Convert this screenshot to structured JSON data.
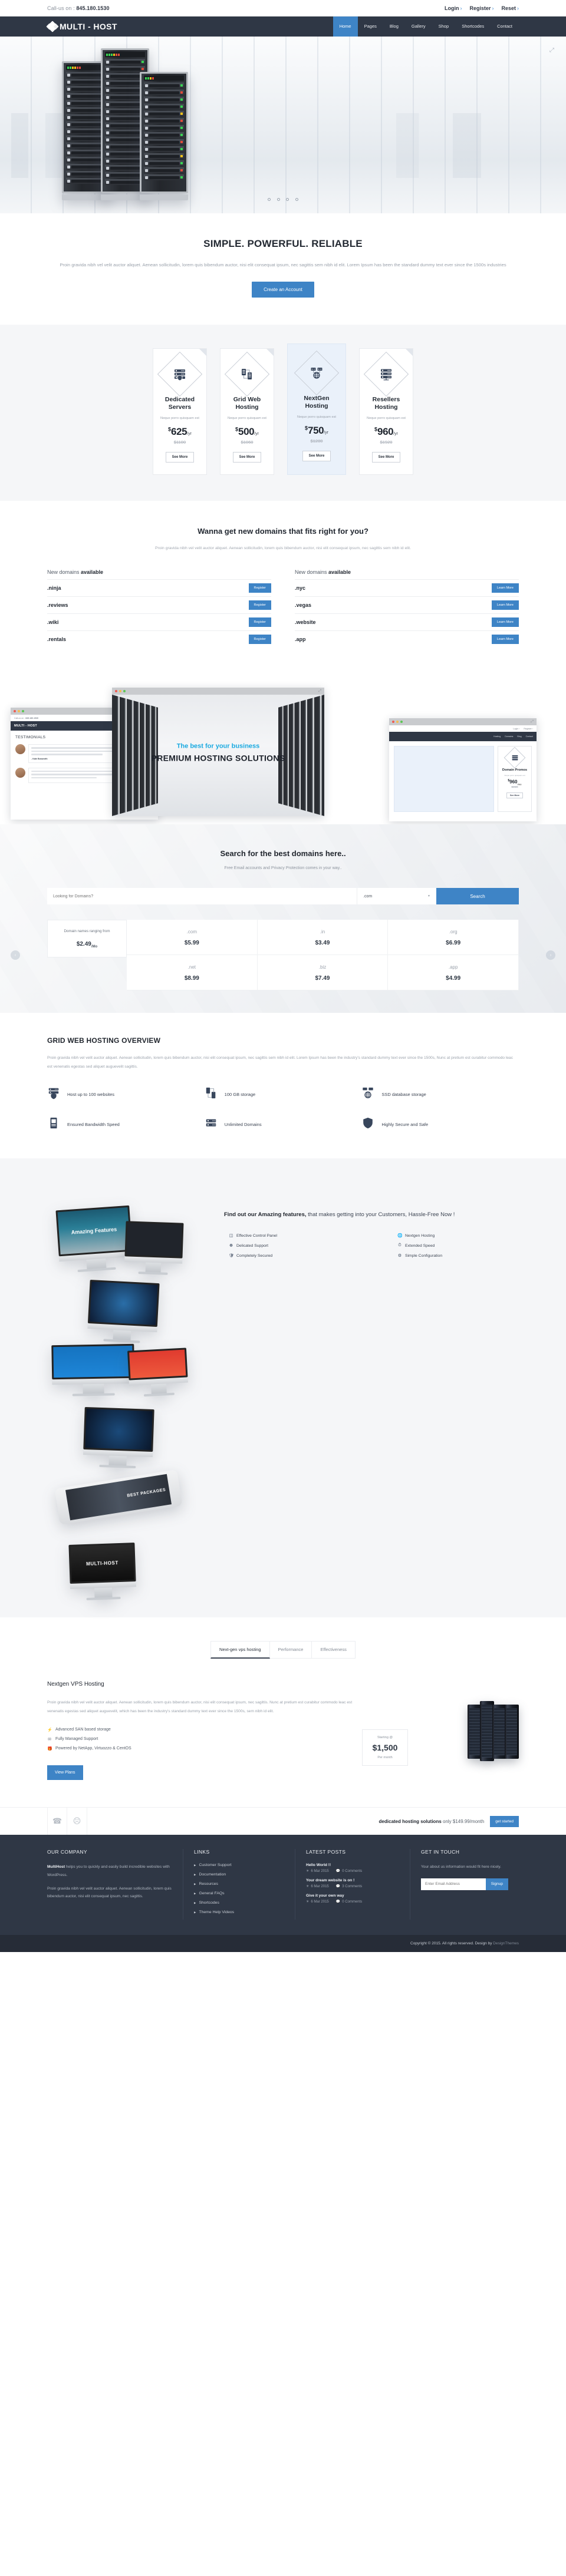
{
  "topbar": {
    "call_prefix": "Call-us on : ",
    "phone": "845.180.1530",
    "links": [
      {
        "label": "Login",
        "arrow": "›"
      },
      {
        "label": "Register",
        "arrow": "›"
      },
      {
        "label": "Reset",
        "arrow": "›"
      }
    ]
  },
  "header": {
    "brand": "MULTI - HOST",
    "nav": [
      {
        "label": "Home",
        "active": true
      },
      {
        "label": "Pages",
        "active": false
      },
      {
        "label": "Blog",
        "active": false
      },
      {
        "label": "Gallery",
        "active": false
      },
      {
        "label": "Shop",
        "active": false
      },
      {
        "label": "Shortcodes",
        "active": false
      },
      {
        "label": "Contact",
        "active": false
      }
    ]
  },
  "hero": {
    "slider_dots": 4,
    "expand_icon": "expand-icon"
  },
  "intro": {
    "title": "SIMPLE. POWERFUL. RELIABLE",
    "paragraph": "Proin gravida nibh vel velit auctor aliquet. Aenean sollicitudin, lorem quis bibendum auctor, nisi elit consequat ipsum, nec sagittis sem nibh id elit. Lorem Ipsum has been the  standard dummy text ever since the 1500s industries",
    "cta_label": "Create an Account"
  },
  "pricing": {
    "plans": [
      {
        "name": "Dedicated Servers",
        "sub": "Neque porro quisquam est",
        "cur": "$",
        "amount": "625",
        "per": "/yr",
        "old": "$1100",
        "button": "See More",
        "icon": "server-shield-icon",
        "featured": false
      },
      {
        "name": "Grid Web Hosting",
        "sub": "Neque porro quisquam est",
        "cur": "$",
        "amount": "500",
        "per": "/yr",
        "old": "$1060",
        "button": "See More",
        "icon": "grid-servers-icon",
        "featured": false
      },
      {
        "name": "NextGen Hosting",
        "sub": "Neque porro quisquam est",
        "cur": "$",
        "amount": "750",
        "per": "/yr",
        "old": "$1280",
        "button": "See More",
        "icon": "globe-servers-icon",
        "featured": true
      },
      {
        "name": "Resellers Hosting",
        "sub": "Neque porro quisquam est",
        "cur": "$",
        "amount": "960",
        "per": "/yr",
        "old": "$1920",
        "button": "See More",
        "icon": "rack-network-icon",
        "featured": false
      }
    ]
  },
  "domains": {
    "title": "Wanna get new domains that fits right for you?",
    "lead": "Proin gravida nibh vel velit auctor aliquet. Aenean sollicitudin, lorem quis bibendum auctor, nisi elit consequat ipsum, nec sagittis sem nibh id elit.",
    "col1_title_normal": "New domains ",
    "col1_title_bold": "available",
    "col2_title_normal": "New domains ",
    "col2_title_bold": "available",
    "col1": [
      {
        "tld": ".ninja",
        "action": "Register"
      },
      {
        "tld": ".reviews",
        "action": "Register"
      },
      {
        "tld": ".wiki",
        "action": "Register"
      },
      {
        "tld": ".rentals",
        "action": "Register"
      }
    ],
    "col2": [
      {
        "tld": ".nyc",
        "action": "Learn More"
      },
      {
        "tld": ".vegas",
        "action": "Learn More"
      },
      {
        "tld": ".website",
        "action": "Learn More"
      },
      {
        "tld": ".app",
        "action": "Learn More"
      }
    ]
  },
  "showcase": {
    "mid_tagline": "The best for your business",
    "mid_title": "PREMIUM HOSTING SOLUTIONS",
    "left_call_prefix": "Call-us on : ",
    "left_phone": "845.180.1530",
    "left_brand": "MULTI - HOST",
    "left_heading": "TESTIMONIALS",
    "left_author": "- Kate Bosworth",
    "right_links": [
      {
        "label": "Login ›"
      },
      {
        "label": "Register ›"
      }
    ],
    "right_nav": [
      "Hosting",
      "Domains",
      "Blog",
      "Contact"
    ],
    "promo": {
      "name": "Domain Promos",
      "sub": "Neque porro quisquam est",
      "cur": "$",
      "amount": "960",
      "per": "/mo",
      "old": "$1920",
      "button": "See More"
    }
  },
  "search": {
    "title": "Search for the best domains here..",
    "sub": "Free Email accounts and Privacy Protection comes in your way..",
    "placeholder": "Looking for Domains?",
    "selected_tld": ".com",
    "button": "Search",
    "prev_icon": "chevron-left-icon",
    "next_icon": "chevron-right-icon",
    "first_cell_text": "Domain names ranging from",
    "first_cell_price": "$2.49",
    "first_cell_unit": "/Mo",
    "tlds": [
      {
        "name": ".com",
        "price": "$5.99"
      },
      {
        "name": ".in",
        "price": "$3.49"
      },
      {
        "name": ".org",
        "price": "$6.99"
      },
      {
        "name": ".net",
        "price": "$8.99"
      },
      {
        "name": ".biz",
        "price": "$7.49"
      },
      {
        "name": ".app",
        "price": "$4.99"
      }
    ]
  },
  "overview": {
    "title": "GRID WEB HOSTING OVERVIEW",
    "paragraph": "Proin gravida nibh vel velit auctor aliquet. Aenean sollicitudin, lorem quis bibendum auctor, nisi elit consequat ipsum, nec sagittis sem nibh id elit. Lorem Ipsum has been the industry's standard dummy text ever since the 1500s, Nunc at pretium est curabitur commodo leac est venenatis egestas sed aliquet auguevelit sagittis.",
    "items": [
      {
        "label": "Host up to 100 websites",
        "icon": "server-shield-icon"
      },
      {
        "label": "100 GB storage",
        "icon": "grid-servers-icon"
      },
      {
        "label": "SSD database storage",
        "icon": "globe-servers-icon"
      },
      {
        "label": "Ensured Bandwidth Speed",
        "icon": "tower-server-icon"
      },
      {
        "label": "Unlimited Domains",
        "icon": "rack-server-icon"
      },
      {
        "label": "Highly Secure and Safe",
        "icon": "shield-icon"
      }
    ]
  },
  "features": {
    "heading_bold": "Find out our Amazing features,",
    "heading_rest": " that makes getting into your Customers, Hassle-Free Now !",
    "items": [
      {
        "label": "Effective Control Panel",
        "icon": "control-panel-icon"
      },
      {
        "label": "Nextgen Hosting",
        "icon": "globe-icon"
      },
      {
        "label": "Delicated Support",
        "icon": "support-icon"
      },
      {
        "label": "Extended Speed",
        "icon": "speed-icon"
      },
      {
        "label": "Completely Secured",
        "icon": "shield-icon"
      },
      {
        "label": "Simple Configuration",
        "icon": "gear-icon"
      }
    ],
    "devices": [
      {
        "name": "imac-amazing-features",
        "screen_text": "Amazing Features"
      },
      {
        "name": "imac-dark-pricing",
        "screen_text": ""
      },
      {
        "name": "imac-touch-tech",
        "screen_text": ""
      },
      {
        "name": "imac-support-blue",
        "screen_text": ""
      },
      {
        "name": "imac-solutions-red",
        "screen_text": ""
      },
      {
        "name": "imac-hands-icons",
        "screen_text": ""
      },
      {
        "name": "phone-best-packages",
        "screen_text": "BEST PACKAGES"
      },
      {
        "name": "imac-multihost-bw",
        "screen_text": "MULTI-HOST"
      }
    ]
  },
  "vps": {
    "tabs": [
      {
        "label": "Next-gen vps hosting",
        "active": true
      },
      {
        "label": "Performance",
        "active": false
      },
      {
        "label": "Effectiveness",
        "active": false
      }
    ],
    "title": "Nextgen VPS Hosting",
    "paragraph": "Proin gravida nibh vel velit auctor aliquet. Aenean sollicitudin, lorem quis bibendum auctor, nisi elit consequat ipsum, nec sagittis. Nunc at pretium est curabitur commodo leac est venenatis egestas sed aliquet auguevelit, which has been the industry's standard dummy text ever since the 1500s, sem nibh id elit.",
    "bullets": [
      {
        "label": "Advanced SAN based storage",
        "icon": "bolt-icon"
      },
      {
        "label": "Fully Managed Support",
        "icon": "support-icon"
      },
      {
        "label": "Powered by NetApp, Virtuozzo & CentOS",
        "icon": "gift-icon"
      }
    ],
    "button": "View Plans",
    "price_label": "Starting @",
    "price_value": "$1,500",
    "price_period": "Per month"
  },
  "cta": {
    "phone_icon": "phone-icon",
    "headset_icon": "headset-icon",
    "bold": "dedicated hosting solutions",
    "rest": " only $149.99/month",
    "button": "get started"
  },
  "footer": {
    "col1_title": "OUR COMPANY",
    "col1_brand": "MultiHost",
    "col1_p1_rest": " helps you to quickly and easily build incredible websites with WordPress.",
    "col1_p2": "Proin gravida nibh vel velit auctor aliquet. Aenean sollicitudin, lorem quis bibendum auctor, nisi elit consequat ipsum, nec sagittis.",
    "col2_title": "LINKS",
    "links": [
      "Customer Support",
      "Documentation",
      "Resources",
      "General FAQs",
      "Shortcodes",
      "Theme Help Videos"
    ],
    "col3_title": "LATEST POSTS",
    "posts": [
      {
        "title": "Hello World !!",
        "date": "6 Mar 2015",
        "comments": "0 Comments"
      },
      {
        "title": "Your dream website is on !",
        "date": "6 Mar 2015",
        "comments": "3 Comments"
      },
      {
        "title": "Give it your own way",
        "date": "6 Mar 2015",
        "comments": "0 Comments"
      }
    ],
    "col4_title": "GET IN TOUCH",
    "col4_text": "Your about us information would fit here nicely.",
    "email_placeholder": "Enter Email Address",
    "signup_label": "Signup",
    "copyright": "Copyright © 2015. All rights reserved. Design by ",
    "designer": "DesignThemes"
  },
  "colors": {
    "accent": "#3e84c6",
    "dark": "#2f3745",
    "darker": "#262c37",
    "muted": "#9aa1ab"
  }
}
